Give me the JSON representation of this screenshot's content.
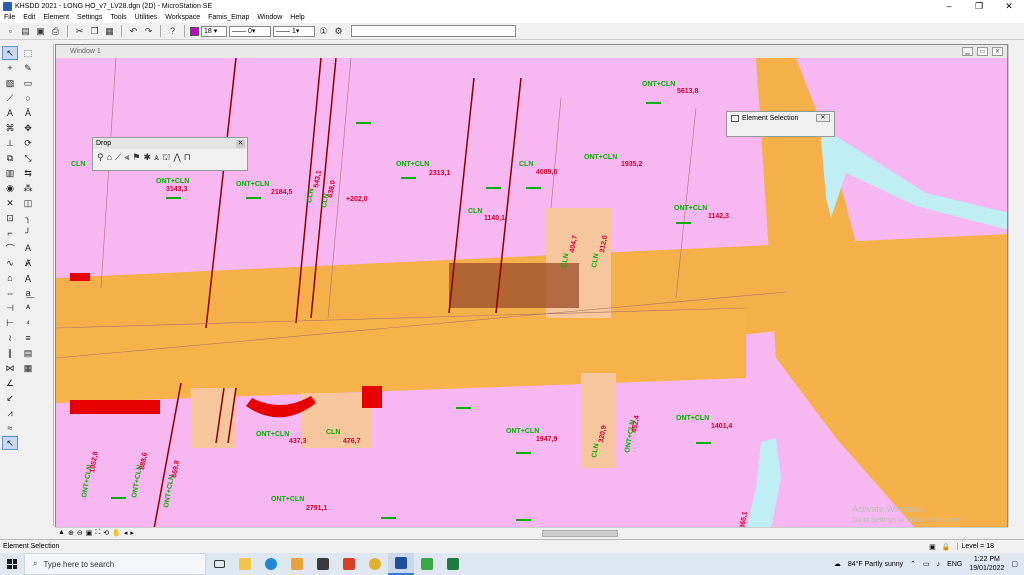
{
  "window": {
    "title": "KHSDD 2021 - LONG HO_v7_LV28.dgn (2D) - MicroStation SE",
    "minimize": "–",
    "maximize": "❐",
    "close": "✕"
  },
  "menu": [
    "File",
    "Edit",
    "Element",
    "Settings",
    "Tools",
    "Utilities",
    "Workspace",
    "Famis_Emap",
    "Window",
    "Help"
  ],
  "toolbar": {
    "level_value": "18",
    "style_value": "0",
    "weight_value": "1",
    "active_color": "#c800c8"
  },
  "view": {
    "title": "Window 1"
  },
  "drop_palette": {
    "title": "Drop"
  },
  "element_selection": {
    "title": "Element Selection"
  },
  "status": {
    "left": "Element Selection",
    "level": "Level = 18"
  },
  "watermark": {
    "line1": "Activate Windows",
    "line2": "Go to Settings to activate Windows."
  },
  "taskbar": {
    "search_placeholder": "Type here to search",
    "weather": "84°F  Partly sunny",
    "lang": "ENG",
    "time": "1:22 PM",
    "date": "19/01/2022"
  },
  "map": {
    "parcels": [
      {
        "code": "CLN",
        "area": ""
      },
      {
        "code": "ONT+CLN",
        "area": "3143,3"
      },
      {
        "code": "ONT+CLN",
        "area": "2184,5"
      },
      {
        "code": "CLN",
        "area": "543,1"
      },
      {
        "code": "CLN",
        "area": "638,0"
      },
      {
        "code": "",
        "area": "+202,0"
      },
      {
        "code": "ONT+CLN",
        "area": "2313,1"
      },
      {
        "code": "CLN",
        "area": "4089,6"
      },
      {
        "code": "ONT+CLN",
        "area": "1935,2"
      },
      {
        "code": "ONT+CLN",
        "area": "5613,8"
      },
      {
        "code": "CLN",
        "area": "1140,1"
      },
      {
        "code": "ONT+CLN",
        "area": "1142,3"
      },
      {
        "code": "CLN",
        "area": "404,7"
      },
      {
        "code": "CLN",
        "area": "312,0"
      },
      {
        "code": "ONT+CLN",
        "area": "437,3"
      },
      {
        "code": "CLN",
        "area": "476,7"
      },
      {
        "code": "ONT+CLN",
        "area": "1947,9"
      },
      {
        "code": "CLN",
        "area": "320,9"
      },
      {
        "code": "ONT+CLN",
        "area": "452,4"
      },
      {
        "code": "ONT+CLN",
        "area": "1401,4"
      },
      {
        "code": "ONT+CLN",
        "area": "1052,8"
      },
      {
        "code": "ONT+CLN",
        "area": "888,6"
      },
      {
        "code": "ONT+CLN",
        "area": "669,8"
      },
      {
        "code": "ONT+CLN",
        "area": "2791,1"
      },
      {
        "code": "",
        "area": "865,1"
      }
    ]
  }
}
